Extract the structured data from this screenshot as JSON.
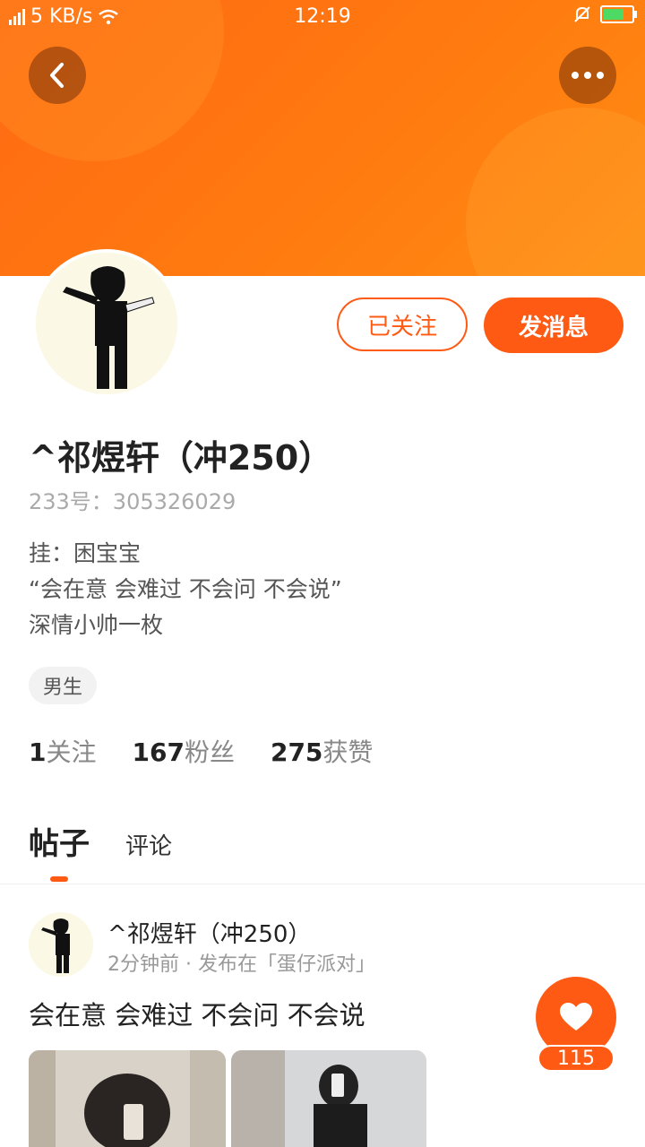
{
  "status_bar": {
    "network": "5 KB/s",
    "time": "12:19"
  },
  "actions": {
    "follow_label": "已关注",
    "message_label": "发消息"
  },
  "profile": {
    "name": "^祁煜轩（冲250）",
    "id_text": "233号：305326029",
    "bio": [
      "挂：困宝宝",
      "“会在意 会难过 不会问 不会说”",
      "深情小帅一枚"
    ],
    "gender_tag": "男生"
  },
  "stats": [
    {
      "value": "1",
      "label": "关注"
    },
    {
      "value": "167",
      "label": "粉丝"
    },
    {
      "value": "275",
      "label": "获赞"
    }
  ],
  "tabs": [
    {
      "label": "帖子"
    },
    {
      "label": "评论"
    }
  ],
  "post": {
    "author": "^祁煜轩（冲250）",
    "meta": "2分钟前 · 发布在「蛋仔派对」",
    "text": "会在意 会难过 不会问 不会说",
    "like_count": "115"
  },
  "colors": {
    "accent": "#ff5a14",
    "header": "#ff7a10"
  },
  "icons": [
    "back-icon",
    "more-icon",
    "heart-icon",
    "wifi-icon",
    "signal-icon",
    "battery-icon",
    "mute-icon"
  ]
}
